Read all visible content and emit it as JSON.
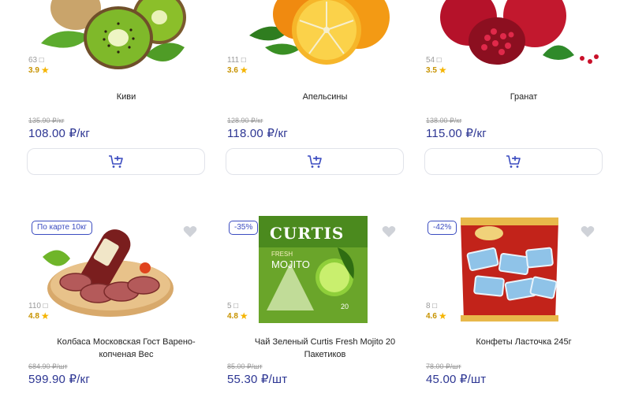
{
  "products_row1": [
    {
      "reviews": "63",
      "rating": "3.9",
      "name": "Киви",
      "old_price": "135.90 ₽/кг",
      "price": "108.00 ₽/кг"
    },
    {
      "reviews": "111",
      "rating": "3.6",
      "name": "Апельсины",
      "old_price": "128.90 ₽/кг",
      "price": "118.00 ₽/кг"
    },
    {
      "reviews": "54",
      "rating": "3.5",
      "name": "Гранат",
      "old_price": "138.00 ₽/кг",
      "price": "115.00 ₽/кг"
    }
  ],
  "products_row2": [
    {
      "badge": "По карте 10кг",
      "reviews": "110",
      "rating": "4.8",
      "name_line1": "Колбаса Московская Гост Варено-",
      "name_line2": "копченая Вес",
      "old_price": "684.90 ₽/шт",
      "price": "599.90 ₽/кг"
    },
    {
      "badge": "-35%",
      "reviews": "5",
      "rating": "4.8",
      "name_line1": "Чай Зеленый Curtis Fresh Mojito 20",
      "name_line2": "Пакетиков",
      "old_price": "85.00 ₽/шт",
      "price": "55.30 ₽/шт",
      "brand": "CURTIS",
      "brand_sub1": "FRESH",
      "brand_sub2": "MOJITO",
      "pack_count": "20"
    },
    {
      "badge": "-42%",
      "reviews": "8",
      "rating": "4.6",
      "name_line1": "Конфеты Ласточка 245г",
      "name_line2": "",
      "old_price": "78.00 ₽/шт",
      "price": "45.00 ₽/шт"
    }
  ],
  "icons": {
    "cart": "add-to-cart-icon",
    "heart": "favorite-heart-icon",
    "star": "rating-star-icon",
    "reviews": "reviews-icon"
  },
  "colors": {
    "price": "#2d3693",
    "badge": "#3b4cc0",
    "star": "#f5b400"
  }
}
